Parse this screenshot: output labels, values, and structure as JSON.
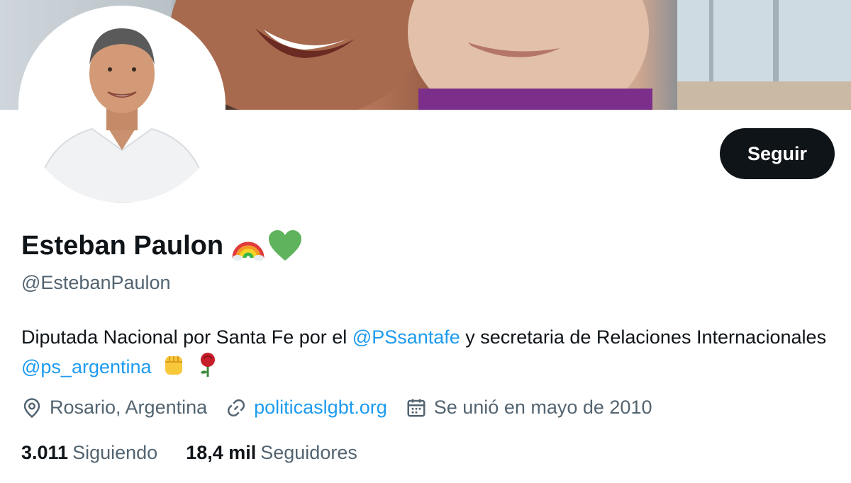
{
  "profile": {
    "name": "Esteban Paulon",
    "name_emojis": [
      "rainbow-emoji",
      "green-heart-emoji"
    ],
    "handle": "@EstebanPaulon",
    "follow_label": "Seguir",
    "bio": {
      "part1": "Diputada Nacional por Santa Fe por el ",
      "mention1": "@PSsantafe",
      "part2": " y secretaria de Relaciones Internacionales ",
      "mention2": "@ps_argentina",
      "emojis": [
        "raised-fist-emoji",
        "rose-emoji"
      ]
    },
    "location": "Rosario, Argentina",
    "website": "politicaslgbt.org",
    "joined": "Se unió en mayo de 2010",
    "following_count": "3.011",
    "following_label": "Siguiendo",
    "followers_count": "18,4 mil",
    "followers_label": "Seguidores"
  },
  "colors": {
    "accent": "#1d9bf0",
    "text_primary": "#0f1419",
    "text_secondary": "#536471",
    "button_bg": "#0f1419"
  }
}
